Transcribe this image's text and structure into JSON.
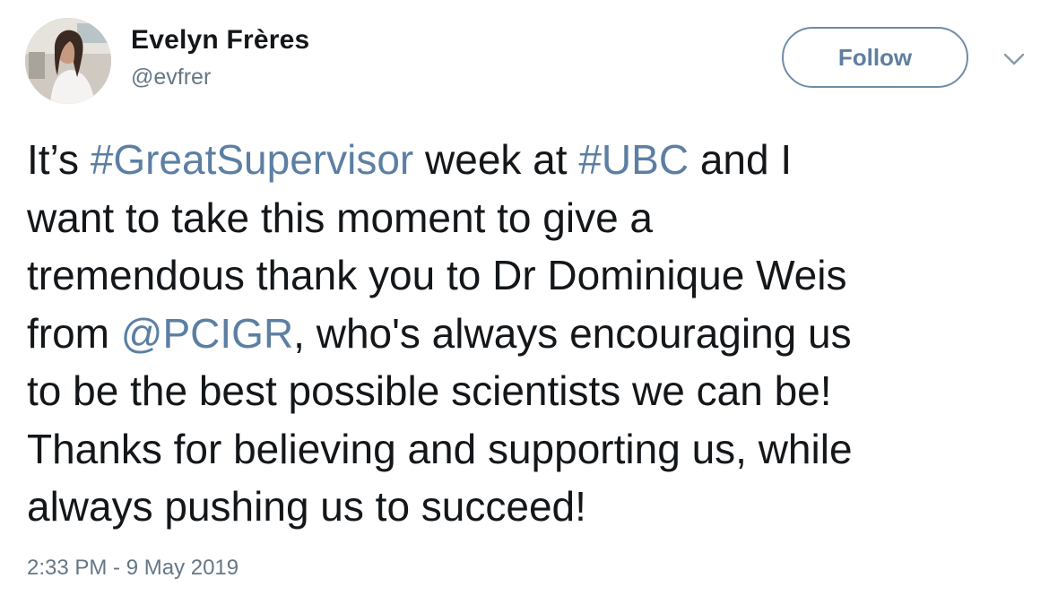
{
  "user": {
    "display_name": "Evelyn Frères",
    "username": "@evfrer"
  },
  "actions": {
    "follow_label": "Follow"
  },
  "tweet": {
    "lines": [
      [
        {
          "type": "text",
          "text": "It’s "
        },
        {
          "type": "hashtag",
          "text": "#GreatSupervisor"
        },
        {
          "type": "text",
          "text": " week at "
        },
        {
          "type": "hashtag",
          "text": "#UBC"
        },
        {
          "type": "text",
          "text": " and I"
        }
      ],
      [
        {
          "type": "text",
          "text": "want to take this moment to give a"
        }
      ],
      [
        {
          "type": "text",
          "text": "tremendous thank you to Dr Dominique Weis"
        }
      ],
      [
        {
          "type": "text",
          "text": "from "
        },
        {
          "type": "mention",
          "text": "@PCIGR"
        },
        {
          "type": "text",
          "text": ", who's always encouraging us"
        }
      ],
      [
        {
          "type": "text",
          "text": "to be the best possible scientists we can be!"
        }
      ],
      [
        {
          "type": "text",
          "text": "Thanks for believing and supporting us, while"
        }
      ],
      [
        {
          "type": "text",
          "text": "always pushing us to succeed!"
        }
      ]
    ],
    "timestamp": "2:33 PM - 9 May 2019"
  },
  "colors": {
    "link": "#5c7fa3",
    "text": "#14171a",
    "muted": "#657786",
    "follow_border": "#6f8ca8"
  },
  "icons": {
    "more": "chevron-down-icon",
    "avatar": "avatar"
  }
}
